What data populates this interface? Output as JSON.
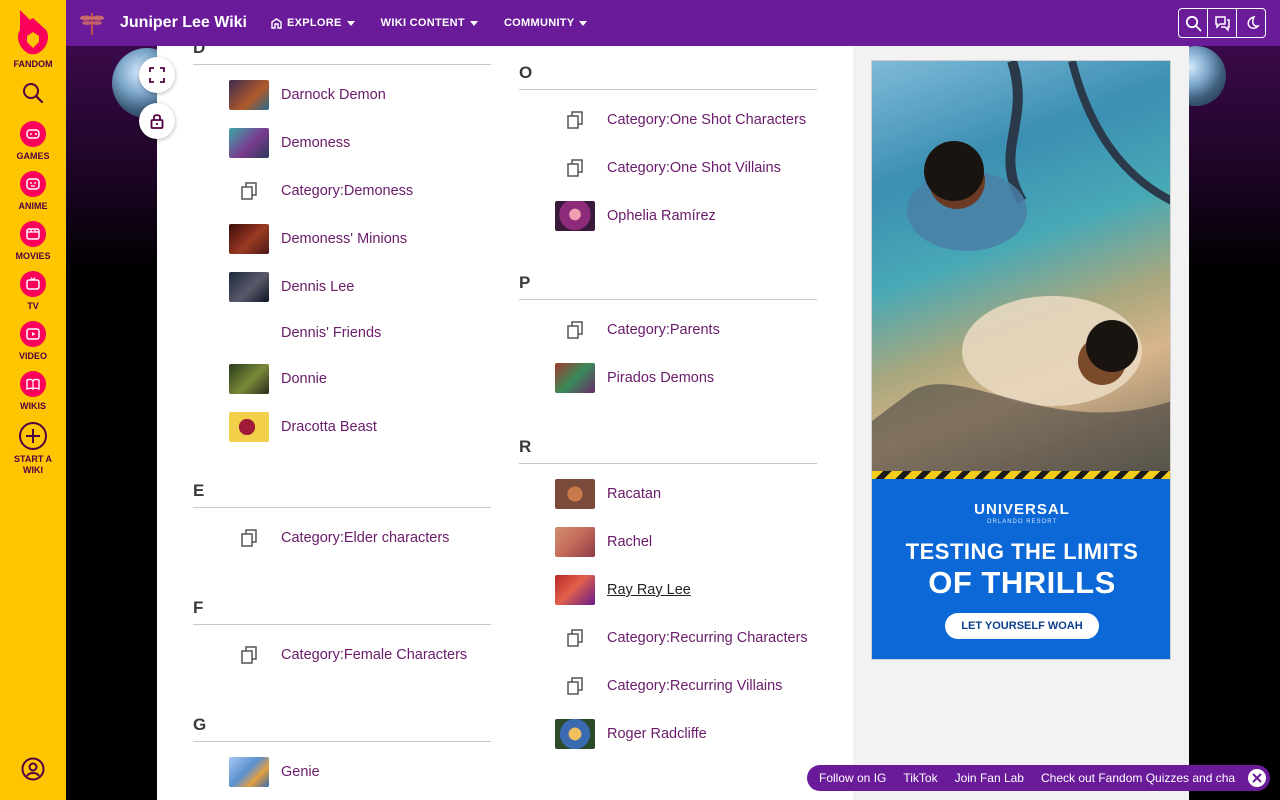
{
  "rail": {
    "logo_label": "FANDOM",
    "items": [
      {
        "label": "GAMES",
        "icon": "gamepad-icon"
      },
      {
        "label": "ANIME",
        "icon": "anime-icon"
      },
      {
        "label": "MOVIES",
        "icon": "movies-icon"
      },
      {
        "label": "TV",
        "icon": "tv-icon"
      },
      {
        "label": "VIDEO",
        "icon": "video-icon"
      },
      {
        "label": "WIKIS",
        "icon": "book-icon"
      }
    ],
    "start_wiki_line1": "START A",
    "start_wiki_line2": "WIKI"
  },
  "header": {
    "wiki_name": "Juniper Lee Wiki",
    "nav": [
      "EXPLORE",
      "WIKI CONTENT",
      "COMMUNITY"
    ]
  },
  "left_column": {
    "sections": [
      {
        "letter": "D",
        "entries": [
          {
            "label": "Darnock Demon",
            "kind": "thumb",
            "color": "#3a2a4e"
          },
          {
            "label": "Demoness",
            "kind": "thumb",
            "color": "#3fa6a8"
          },
          {
            "label": "Category:Demoness",
            "kind": "category"
          },
          {
            "label": "Demoness' Minions",
            "kind": "thumb",
            "color": "#7a2418"
          },
          {
            "label": "Dennis Lee",
            "kind": "thumb",
            "color": "#1c2a3c"
          },
          {
            "label": "Dennis' Friends",
            "kind": "none"
          },
          {
            "label": "Donnie",
            "kind": "thumb",
            "color": "#4e5a2a"
          },
          {
            "label": "Dracotta Beast",
            "kind": "thumb",
            "color": "#f2d04a"
          }
        ]
      },
      {
        "letter": "E",
        "entries": [
          {
            "label": "Category:Elder characters",
            "kind": "category"
          }
        ]
      },
      {
        "letter": "F",
        "entries": [
          {
            "label": "Category:Female Characters",
            "kind": "category"
          }
        ]
      },
      {
        "letter": "G",
        "entries": [
          {
            "label": "Genie",
            "kind": "thumb",
            "color": "#5a8fd0"
          }
        ]
      }
    ]
  },
  "right_column": {
    "sections": [
      {
        "letter": "O",
        "entries": [
          {
            "label": "Category:One Shot Characters",
            "kind": "category"
          },
          {
            "label": "Category:One Shot Villains",
            "kind": "category"
          },
          {
            "label": "Ophelia Ramírez",
            "kind": "thumb",
            "color": "#8e2a7a"
          }
        ]
      },
      {
        "letter": "P",
        "entries": [
          {
            "label": "Category:Parents",
            "kind": "category"
          },
          {
            "label": "Pirados Demons",
            "kind": "thumb",
            "color": "#3a8a5a"
          }
        ]
      },
      {
        "letter": "R",
        "entries": [
          {
            "label": "Racatan",
            "kind": "thumb",
            "color": "#7a4a3a"
          },
          {
            "label": "Rachel",
            "kind": "thumb",
            "color": "#c46a5a"
          },
          {
            "label": "Ray Ray Lee",
            "kind": "thumb",
            "color": "#b8282a",
            "underline": true
          },
          {
            "label": "Category:Recurring Characters",
            "kind": "category"
          },
          {
            "label": "Category:Recurring Villains",
            "kind": "category"
          },
          {
            "label": "Roger Radcliffe",
            "kind": "thumb",
            "color": "#3a6ab0"
          }
        ]
      }
    ]
  },
  "ad": {
    "brand": "UNIVERSAL",
    "brand_sub": "ORLANDO RESORT",
    "headline1": "TESTING THE LIMITS",
    "headline2": "OF THRILLS",
    "cta": "LET YOURSELF WOAH"
  },
  "social": {
    "items": [
      "Follow on IG",
      "TikTok",
      "Join Fan Lab",
      "Check out Fandom Quizzes and cha"
    ]
  }
}
